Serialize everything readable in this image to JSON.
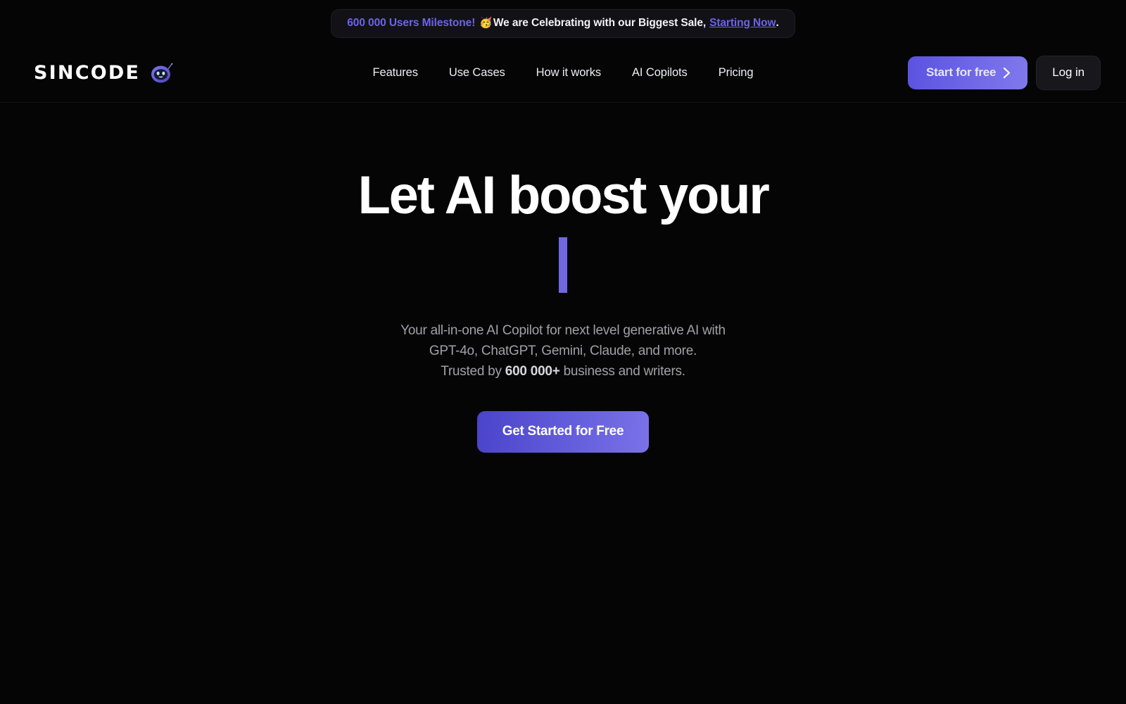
{
  "announcement": {
    "highlight": "600 000 Users Milestone!",
    "emoji": "🥳",
    "message": "We are Celebrating with our Biggest Sale,",
    "link": "Starting Now",
    "period": ".",
    "accent_color": "#6c63e8"
  },
  "header": {
    "brand": {
      "wordmark": "SINCODE",
      "mascot_name": "robot-mascot-icon"
    },
    "nav": [
      {
        "label": "Features"
      },
      {
        "label": "Use Cases"
      },
      {
        "label": "How it works"
      },
      {
        "label": "AI Copilots"
      },
      {
        "label": "Pricing"
      }
    ],
    "actions": {
      "start_label": "Start for free",
      "start_icon": "chevron-right-icon",
      "login_label": "Log in"
    }
  },
  "hero": {
    "title": "Let AI boost your",
    "typed_text": "",
    "caret_color": "#6f68e0",
    "subtitle_line1": "Your all-in-one AI Copilot for next level generative AI with",
    "subtitle_line2": "GPT-4o, ChatGPT, Gemini, Claude, and more.",
    "subtitle_line3_prefix": "Trusted by ",
    "subtitle_line3_bold": "600 000+",
    "subtitle_line3_suffix": " business and writers.",
    "cta_label": "Get Started for Free"
  },
  "theme": {
    "background": "#050506",
    "accent": "#6c63e8",
    "gradient_start": "#4a44cc",
    "gradient_end": "#7a72e8"
  }
}
